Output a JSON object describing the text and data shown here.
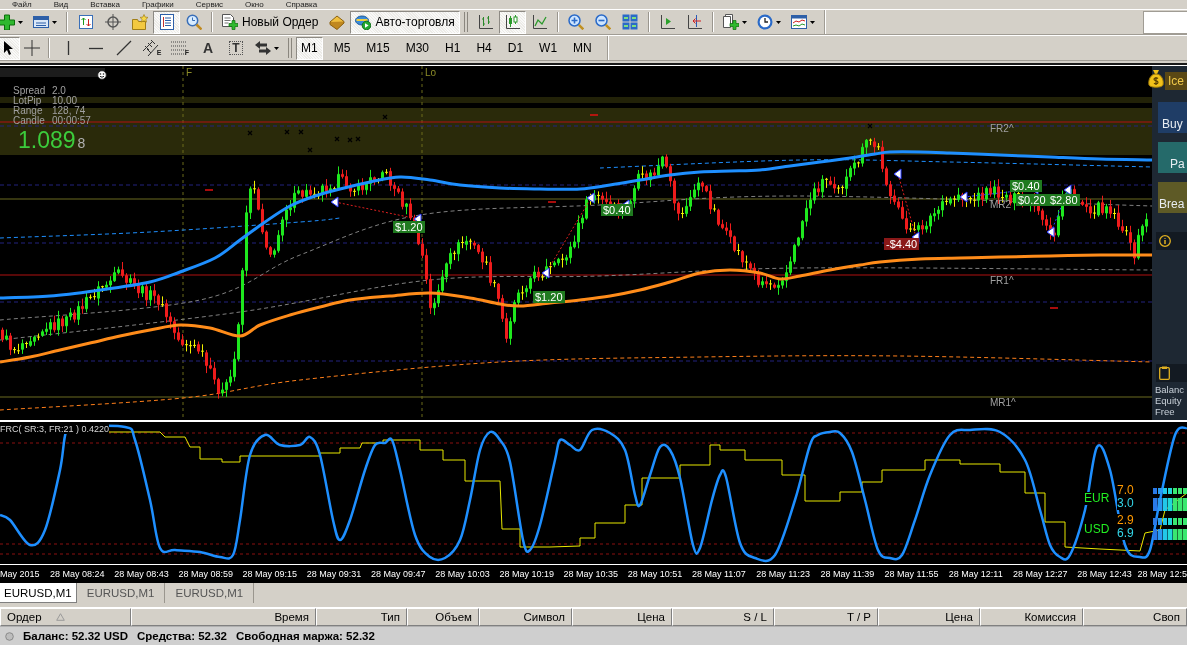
{
  "menu": [
    "Файл",
    "Вид",
    "Вставка",
    "Графики",
    "Сервис",
    "Окно",
    "Справка"
  ],
  "toolbar": [
    {
      "kind": "new-chart",
      "dropdown": true,
      "pressed": false
    },
    {
      "kind": "profiles",
      "dropdown": true,
      "pressed": false
    },
    {
      "kind": "separator"
    },
    {
      "kind": "market-watch",
      "pressed": false
    },
    {
      "kind": "navigator",
      "pressed": false
    },
    {
      "kind": "favorites",
      "pressed": false
    },
    {
      "kind": "data-window",
      "pressed": true
    },
    {
      "kind": "tester",
      "pressed": false
    },
    {
      "kind": "separator"
    },
    {
      "kind": "new-order",
      "label": "Новый Ордер",
      "pressed": false
    },
    {
      "kind": "editor",
      "pressed": false
    },
    {
      "kind": "autotrading",
      "label": "Авто-торговля",
      "pressed": true
    },
    {
      "kind": "grip"
    },
    {
      "kind": "bar-chart",
      "pressed": false
    },
    {
      "kind": "candle-chart",
      "pressed": true
    },
    {
      "kind": "line-chart",
      "pressed": false
    },
    {
      "kind": "separator"
    },
    {
      "kind": "zoom-in",
      "pressed": false
    },
    {
      "kind": "zoom-out",
      "pressed": false
    },
    {
      "kind": "tile",
      "pressed": false
    },
    {
      "kind": "separator"
    },
    {
      "kind": "auto-scroll",
      "pressed": false
    },
    {
      "kind": "chart-shift",
      "pressed": false
    },
    {
      "kind": "separator"
    },
    {
      "kind": "indicators",
      "dropdown": true,
      "pressed": false
    },
    {
      "kind": "periods",
      "dropdown": true,
      "pressed": false
    },
    {
      "kind": "templates",
      "dropdown": true,
      "pressed": false
    }
  ],
  "drawing_tools": [
    {
      "kind": "cursor",
      "pressed": true
    },
    {
      "kind": "crosshair",
      "pressed": false
    },
    {
      "kind": "separator"
    },
    {
      "kind": "vertical-line",
      "pressed": false
    },
    {
      "kind": "horizontal-line",
      "pressed": false
    },
    {
      "kind": "trendline",
      "pressed": false
    },
    {
      "kind": "channel",
      "badge": "E",
      "pressed": false
    },
    {
      "kind": "fibo",
      "badge": "F",
      "pressed": false
    },
    {
      "kind": "text",
      "label": "A",
      "pressed": false
    },
    {
      "kind": "text-label",
      "label": "T",
      "pressed": false
    },
    {
      "kind": "arrows",
      "dropdown": true,
      "pressed": false
    }
  ],
  "timeframes": [
    {
      "label": "M1",
      "selected": true
    },
    {
      "label": "M5",
      "selected": false
    },
    {
      "label": "M15",
      "selected": false
    },
    {
      "label": "M30",
      "selected": false
    },
    {
      "label": "H1",
      "selected": false
    },
    {
      "label": "H4",
      "selected": false
    },
    {
      "label": "D1",
      "selected": false
    },
    {
      "label": "W1",
      "selected": false
    },
    {
      "label": "MN",
      "selected": false
    }
  ],
  "chart": {
    "info": [
      {
        "label": "Spread",
        "value": "2.0"
      },
      {
        "label": "LotPip",
        "value": "10.00"
      },
      {
        "label": "Range",
        "value": "128, 74"
      },
      {
        "label": "Candle",
        "value": "00:00:57"
      }
    ],
    "price": "1.089",
    "price_last_digit": "8",
    "session_markers": [
      "F",
      "Lo"
    ],
    "levels": [
      "FR2^",
      "MR2",
      "FR1^",
      "MR1^"
    ],
    "trades": [
      {
        "text": "$1.20",
        "profit": true
      },
      {
        "text": "$0.40",
        "profit": true
      },
      {
        "text": "$1.20",
        "profit": true
      },
      {
        "text": "-$4.40",
        "profit": false
      },
      {
        "text": "$0.40",
        "profit": true
      },
      {
        "text": "$0.20",
        "profit": true
      },
      {
        "text": "$2.80",
        "profit": true
      }
    ]
  },
  "panel": {
    "title": "Ice",
    "buttons": [
      {
        "kind": "buy",
        "label": "Buy"
      },
      {
        "kind": "partial",
        "label": "Pa"
      },
      {
        "kind": "breakeven",
        "label": "Brea"
      }
    ],
    "account": [
      "Balanc",
      "Equity",
      "Free"
    ]
  },
  "indicator": {
    "title": "FRC( SR:3, FR:21 ) 0.4220",
    "strength": [
      {
        "currency": "EUR",
        "values": [
          {
            "text": "7.0",
            "color": "#ff9900"
          },
          {
            "text": "3.0",
            "color": "#33d6e8"
          }
        ]
      },
      {
        "currency": "USD",
        "values": [
          {
            "text": "2.9",
            "color": "#ff9900"
          },
          {
            "text": "6.9",
            "color": "#33d6e8"
          }
        ]
      }
    ]
  },
  "time_axis": [
    "May 2015",
    "28 May 08:24",
    "28 May 08:43",
    "28 May 08:59",
    "28 May 09:15",
    "28 May 09:31",
    "28 May 09:47",
    "28 May 10:03",
    "28 May 10:19",
    "28 May 10:35",
    "28 May 10:51",
    "28 May 11:07",
    "28 May 11:23",
    "28 May 11:39",
    "28 May 11:55",
    "28 May 12:11",
    "28 May 12:27",
    "28 May 12:43",
    "28 May 12:5"
  ],
  "chart_tabs": [
    {
      "label": "EURUSD,M1",
      "selected": true
    },
    {
      "label": "EURUSD,M1",
      "selected": false
    },
    {
      "label": "EURUSD,M1",
      "selected": false
    }
  ],
  "terminal": {
    "columns": [
      {
        "label": "Ордер",
        "sorted": true
      },
      {
        "label": "Время",
        "sorted": false
      },
      {
        "label": "Тип",
        "sorted": false
      },
      {
        "label": "Объем",
        "sorted": false
      },
      {
        "label": "Символ",
        "sorted": false
      },
      {
        "label": "Цена",
        "sorted": false
      },
      {
        "label": "S / L",
        "sorted": false
      },
      {
        "label": "T / P",
        "sorted": false
      },
      {
        "label": "Цена",
        "sorted": false
      },
      {
        "label": "Комиссия",
        "sorted": false
      },
      {
        "label": "Своп",
        "sorted": false
      }
    ]
  },
  "status_bar": {
    "balance": "Баланс: 52.32 USD",
    "equity": "Средства: 52.32",
    "free_margin": "Свободная маржа: 52.32"
  }
}
